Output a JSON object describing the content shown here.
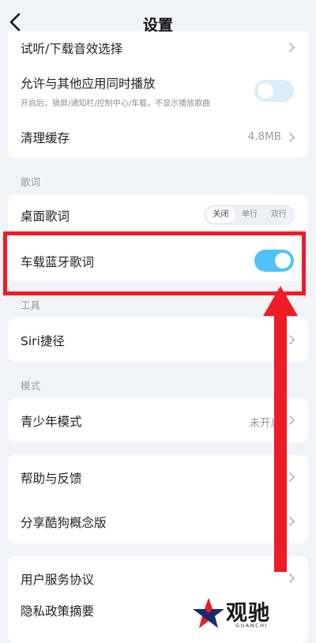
{
  "nav": {
    "title": "设置"
  },
  "rows": {
    "audio_effects": "试听/下载音效选择",
    "mix_play": {
      "label": "允许与其他应用同时播放",
      "desc": "开启后，锁屏/通知栏/控制中心/车载，不显示播放歌曲",
      "enabled": false
    },
    "clear_cache": {
      "label": "清理缓存",
      "value": "4.8MB"
    },
    "desktop_lyrics": {
      "label": "桌面歌词",
      "options": [
        "关闭",
        "单行",
        "双行"
      ],
      "selected": "关闭"
    },
    "car_bt_lyrics": {
      "label": "车载蓝牙歌词",
      "enabled": true
    },
    "siri": "Siri捷径",
    "youth_mode": {
      "label": "青少年模式",
      "value": "未开启"
    },
    "help": "帮助与反馈",
    "share": "分享酷狗概念版",
    "agreement": "用户服务协议",
    "privacy": "隐私政策摘要"
  },
  "sections": {
    "lyrics": "歌词",
    "tools": "工具",
    "mode": "模式"
  },
  "watermark": {
    "name": "观驰",
    "en": "GUANCHI"
  },
  "colors": {
    "accent": "#4fc3f7",
    "toggle_off": "#d9eefa",
    "highlight": "#ee1c25",
    "background": "#f1f3f7"
  }
}
